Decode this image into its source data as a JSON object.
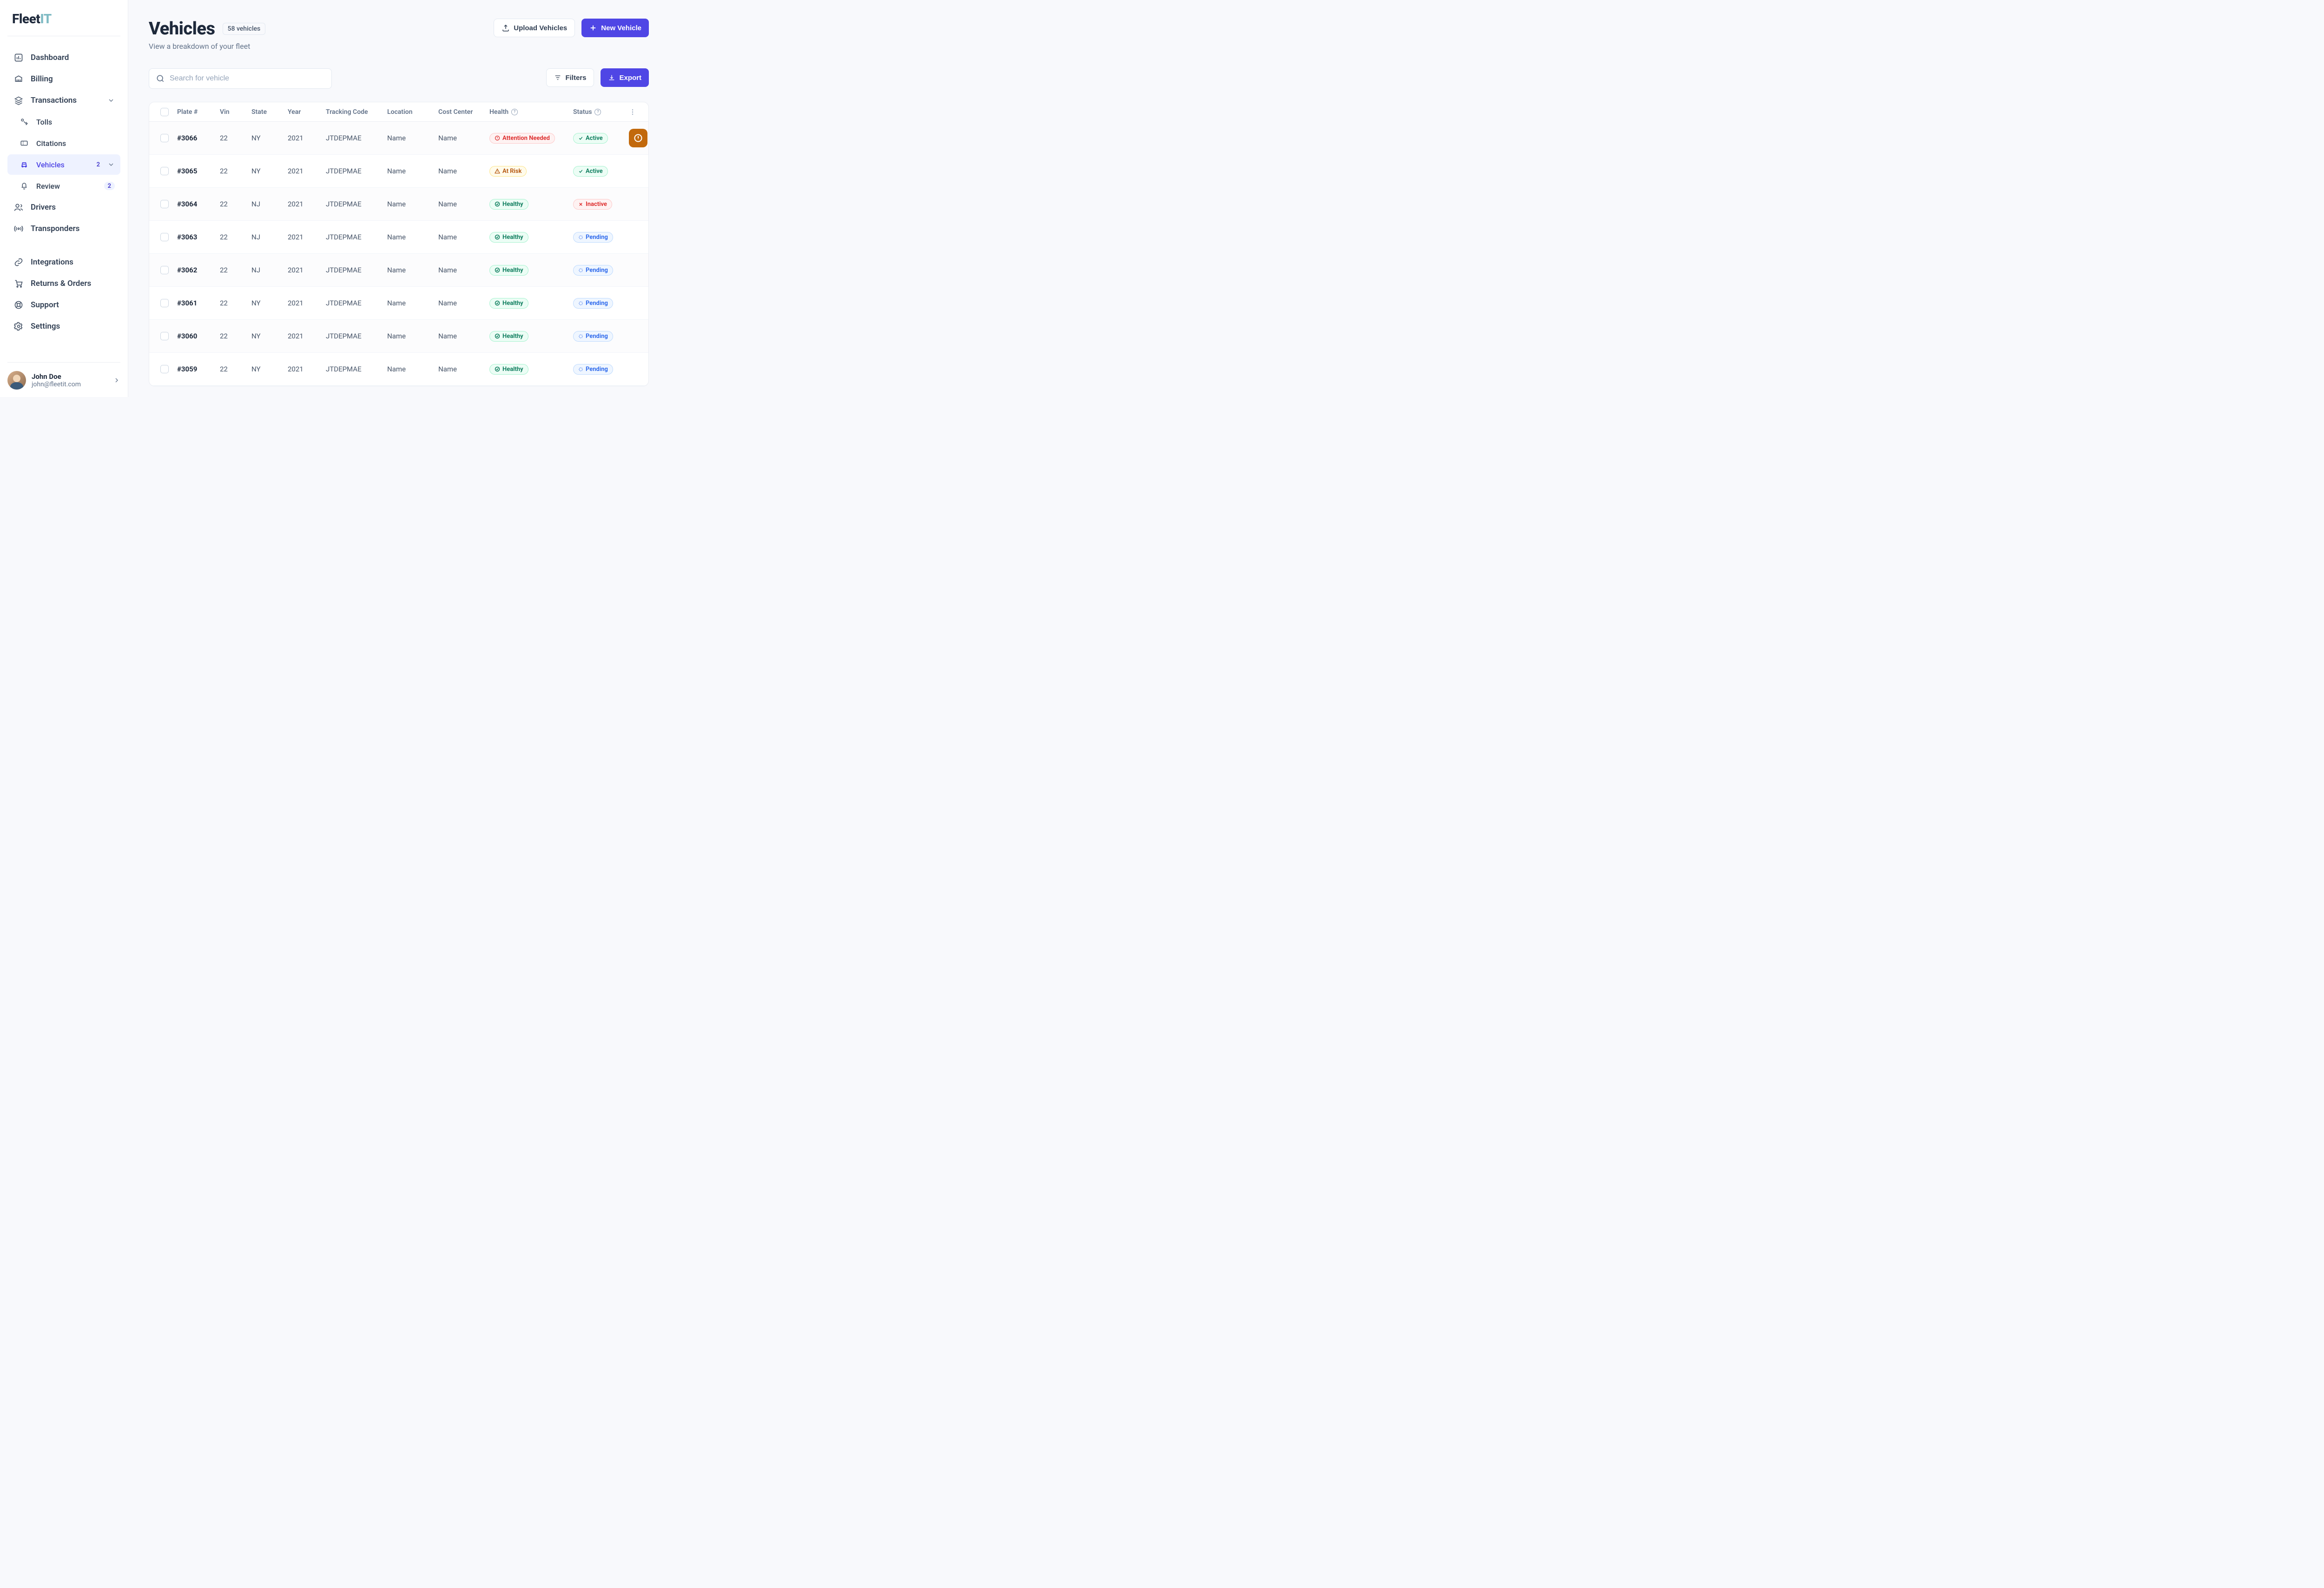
{
  "brand": {
    "a": "Fleet",
    "b": "IT"
  },
  "sidebar": {
    "items": [
      {
        "label": "Dashboard"
      },
      {
        "label": "Billing"
      },
      {
        "label": "Transactions"
      },
      {
        "label": "Tolls"
      },
      {
        "label": "Citations"
      },
      {
        "label": "Vehicles",
        "badge": "2"
      },
      {
        "label": "Review",
        "badge": "2"
      },
      {
        "label": "Drivers"
      },
      {
        "label": "Transponders"
      }
    ],
    "secondary": [
      {
        "label": "Integrations"
      },
      {
        "label": "Returns & Orders"
      },
      {
        "label": "Support"
      },
      {
        "label": "Settings"
      }
    ]
  },
  "user": {
    "name": "John Doe",
    "email": "john@fleetit.com"
  },
  "page": {
    "title": "Vehicles",
    "count_chip": "58 vehicles",
    "subtitle": "View a breakdown of your fleet"
  },
  "actions": {
    "upload": "Upload Vehicles",
    "new": "New Vehicle",
    "filters": "Filters",
    "export": "Export",
    "search_placeholder": "Search for vehicle"
  },
  "table": {
    "headers": [
      "Plate #",
      "Vin",
      "State",
      "Year",
      "Tracking Code",
      "Location",
      "Cost Center",
      "Health",
      "Status"
    ],
    "rows": [
      {
        "plate": "#3066",
        "vin": "22",
        "state": "NY",
        "year": "2021",
        "code": "JTDEPMAE",
        "location": "Name",
        "cost": "Name",
        "health": "attention",
        "status": "active",
        "warn": true
      },
      {
        "plate": "#3065",
        "vin": "22",
        "state": "NY",
        "year": "2021",
        "code": "JTDEPMAE",
        "location": "Name",
        "cost": "Name",
        "health": "risk",
        "status": "active"
      },
      {
        "plate": "#3064",
        "vin": "22",
        "state": "NJ",
        "year": "2021",
        "code": "JTDEPMAE",
        "location": "Name",
        "cost": "Name",
        "health": "healthy",
        "status": "inactive"
      },
      {
        "plate": "#3063",
        "vin": "22",
        "state": "NJ",
        "year": "2021",
        "code": "JTDEPMAE",
        "location": "Name",
        "cost": "Name",
        "health": "healthy",
        "status": "pending"
      },
      {
        "plate": "#3062",
        "vin": "22",
        "state": "NJ",
        "year": "2021",
        "code": "JTDEPMAE",
        "location": "Name",
        "cost": "Name",
        "health": "healthy",
        "status": "pending"
      },
      {
        "plate": "#3061",
        "vin": "22",
        "state": "NY",
        "year": "2021",
        "code": "JTDEPMAE",
        "location": "Name",
        "cost": "Name",
        "health": "healthy",
        "status": "pending"
      },
      {
        "plate": "#3060",
        "vin": "22",
        "state": "NY",
        "year": "2021",
        "code": "JTDEPMAE",
        "location": "Name",
        "cost": "Name",
        "health": "healthy",
        "status": "pending"
      },
      {
        "plate": "#3059",
        "vin": "22",
        "state": "NY",
        "year": "2021",
        "code": "JTDEPMAE",
        "location": "Name",
        "cost": "Name",
        "health": "healthy",
        "status": "pending"
      }
    ]
  },
  "labels": {
    "healthy": "Healthy",
    "attention": "Attention Needed",
    "risk": "At Risk",
    "active": "Active",
    "inactive": "Inactive",
    "pending": "Pending"
  }
}
